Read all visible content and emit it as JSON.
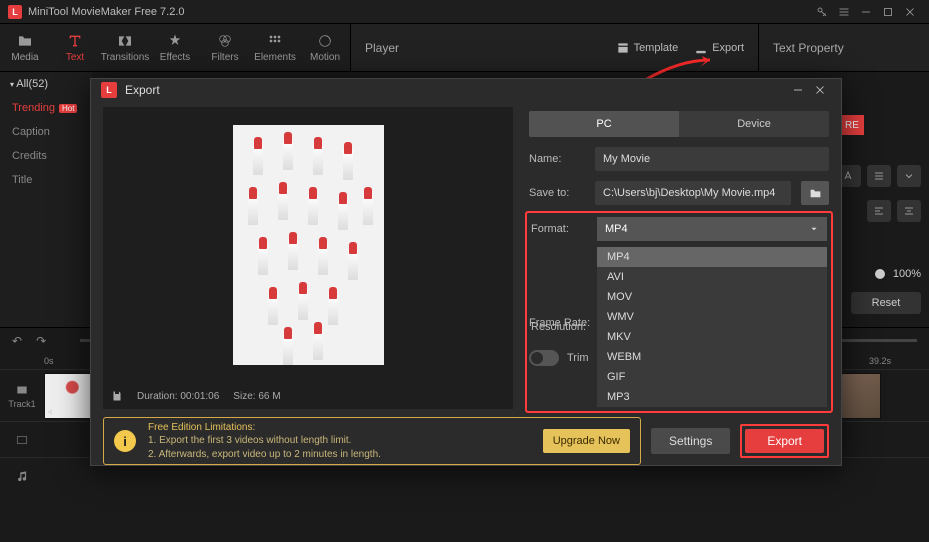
{
  "app": {
    "title": "MiniTool MovieMaker Free 7.2.0"
  },
  "toolbar": {
    "media": "Media",
    "text": "Text",
    "transitions": "Transitions",
    "effects": "Effects",
    "filters": "Filters",
    "elements": "Elements",
    "motion": "Motion"
  },
  "player": {
    "label": "Player",
    "template": "Template",
    "export": "Export"
  },
  "text_property": "Text Property",
  "sidebar": {
    "all": "All(52)",
    "trending": "Trending",
    "hot": "Hot",
    "caption": "Caption",
    "credits": "Credits",
    "title": "Title"
  },
  "bg": {
    "re": "RE",
    "zoom": "100%",
    "reset": "Reset"
  },
  "timeline": {
    "ticks": [
      "0s",
      "39.2s"
    ],
    "track1": "Track1"
  },
  "modal": {
    "title": "Export",
    "tabs": {
      "pc": "PC",
      "device": "Device"
    },
    "name_label": "Name:",
    "name_value": "My Movie",
    "save_label": "Save to:",
    "save_value": "C:\\Users\\bj\\Desktop\\My Movie.mp4",
    "format_label": "Format:",
    "format_value": "MP4",
    "format_options": [
      "MP4",
      "AVI",
      "MOV",
      "WMV",
      "MKV",
      "WEBM",
      "GIF",
      "MP3"
    ],
    "resolution_label": "Resolution:",
    "framerate_label": "Frame Rate:",
    "trim_label": "Trim",
    "duration_label": "Duration:",
    "duration_value": "00:01:06",
    "size_label": "Size:",
    "size_value": "66 M",
    "limitations": {
      "header": "Free Edition Limitations:",
      "line1": "1. Export the first 3 videos without length limit.",
      "line2": "2. Afterwards, export video up to 2 minutes in length."
    },
    "upgrade": "Upgrade Now",
    "settings": "Settings",
    "export": "Export"
  }
}
